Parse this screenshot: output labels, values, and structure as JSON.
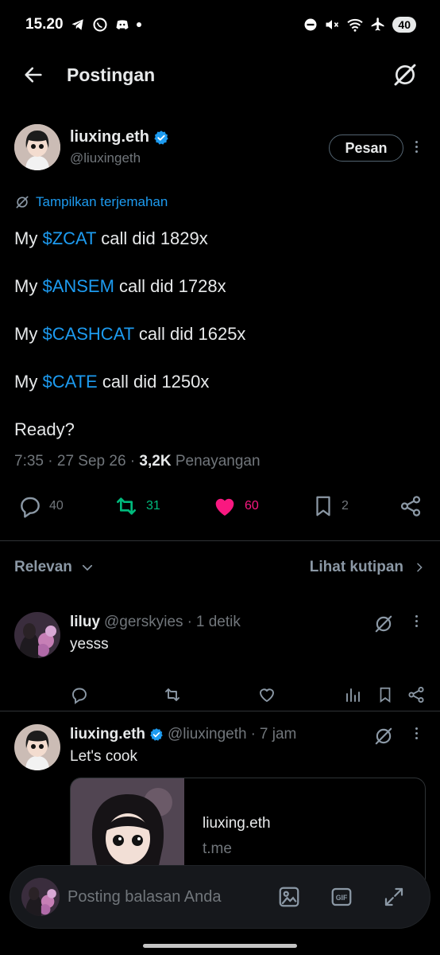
{
  "status_bar": {
    "time": "15.20",
    "battery": "40"
  },
  "header": {
    "title": "Postingan"
  },
  "post": {
    "author_name": "liuxing.eth",
    "author_handle": "@liuxingeth",
    "message_button": "Pesan",
    "translate_label": "Tampilkan terjemahan",
    "lines": [
      {
        "prefix": "My ",
        "cashtag": "$ZCAT",
        "suffix": " call did 1829x"
      },
      {
        "prefix": "My ",
        "cashtag": "$ANSEM",
        "suffix": " call did 1728x"
      },
      {
        "prefix": "My ",
        "cashtag": "$CASHCAT",
        "suffix": " call did 1625x"
      },
      {
        "prefix": "My ",
        "cashtag": "$CATE",
        "suffix": " call did 1250x"
      },
      {
        "prefix": "Ready?",
        "cashtag": "",
        "suffix": ""
      }
    ],
    "time": "7:35",
    "date": "27 Sep 26",
    "views_count": "3,2K",
    "views_label": "Penayangan",
    "replies": "40",
    "reposts": "31",
    "likes": "60",
    "bookmarks": "2"
  },
  "sort": {
    "label": "Relevan",
    "quotes_link": "Lihat kutipan"
  },
  "replies": [
    {
      "name": "liluy",
      "handle": "@gerskyies",
      "time": "1 detik",
      "text": "yesss"
    },
    {
      "name": "liuxing.eth",
      "handle": "@liuxingeth",
      "time": "7 jam",
      "text": "Let's cook",
      "card": {
        "title": "liuxing.eth",
        "domain": "t.me"
      }
    }
  ],
  "compose": {
    "placeholder": "Posting balasan Anda"
  },
  "colors": {
    "accent": "#1d9bf0",
    "repost": "#00ba7c",
    "like": "#f91880",
    "background": "#000000",
    "muted": "#71767b"
  },
  "icons": [
    "back-arrow-icon",
    "grok-icon",
    "verified-badge-icon",
    "translate-icon",
    "reply-icon",
    "repost-icon",
    "heart-icon",
    "bookmark-icon",
    "share-icon",
    "chevron-down-icon",
    "chevron-right-icon",
    "analytics-icon",
    "image-icon",
    "gif-icon",
    "expand-icon"
  ]
}
